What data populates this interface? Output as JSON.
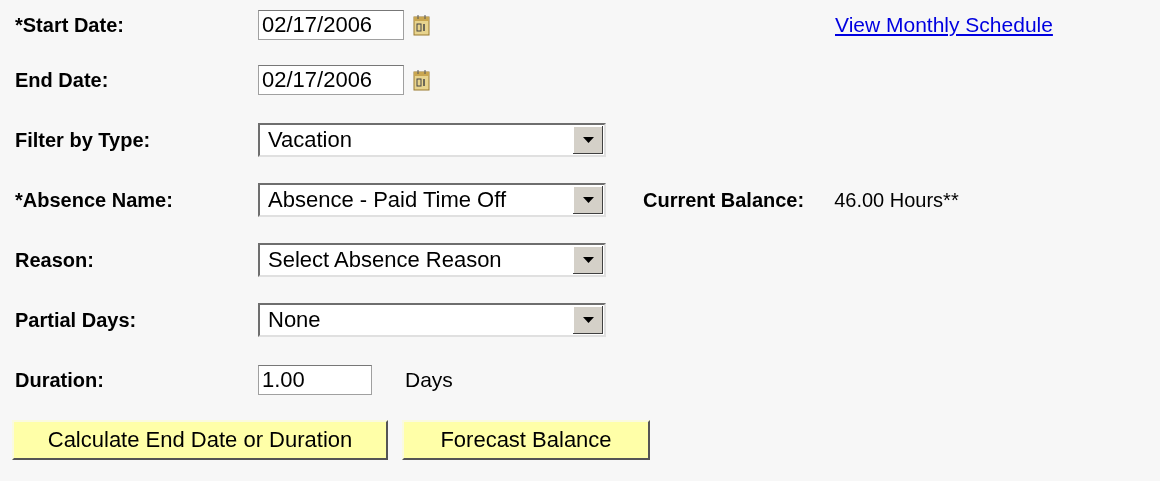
{
  "fields": [
    {
      "kind": "date",
      "label": "*Start Date:",
      "value": "02/17/2006",
      "link": "View Monthly Schedule"
    },
    {
      "kind": "date",
      "label": "End Date:",
      "value": "02/17/2006"
    },
    {
      "kind": "select",
      "label": "Filter by Type:",
      "value": "Vacation"
    },
    {
      "kind": "select",
      "label": "*Absence Name:",
      "value": "Absence - Paid Time Off",
      "balance_label": "Current Balance:",
      "balance_value": "46.00 Hours**"
    },
    {
      "kind": "select",
      "label": "Reason:",
      "value": "Select Absence Reason"
    },
    {
      "kind": "select",
      "label": "Partial Days:",
      "value": "None"
    },
    {
      "kind": "number",
      "label": "Duration:",
      "value": "1.00",
      "unit": "Days"
    }
  ],
  "buttons": [
    "Calculate End Date or Duration",
    "Forecast Balance"
  ]
}
